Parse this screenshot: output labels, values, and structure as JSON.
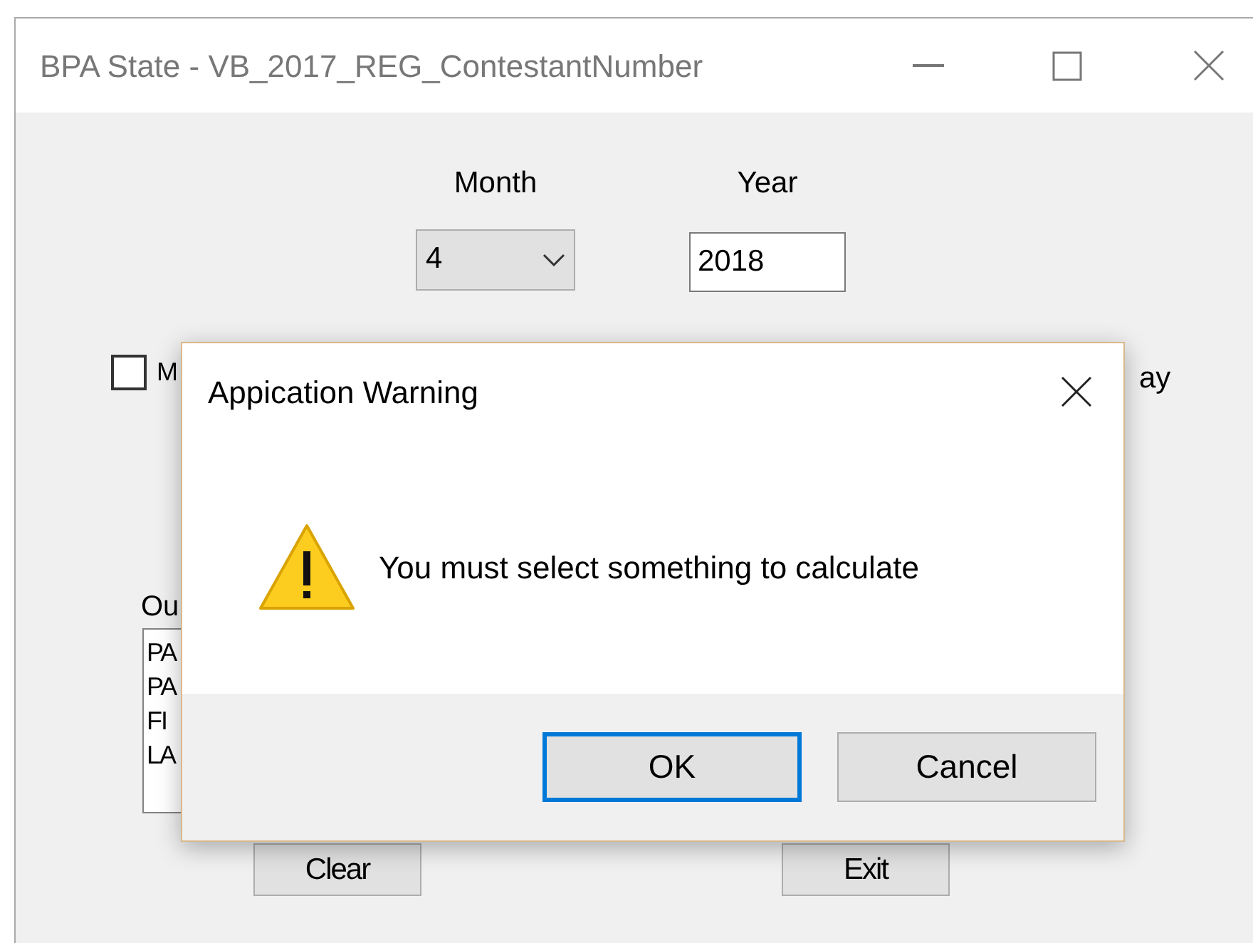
{
  "window": {
    "title": "BPA State - VB_2017_REG_ContestantNumber"
  },
  "month": {
    "label": "Month",
    "value": "4"
  },
  "year": {
    "label": "Year",
    "value": "2018"
  },
  "checkbox": {
    "label": "M",
    "checked": false
  },
  "right_label": "ay",
  "output": {
    "label": "Ou",
    "lines": [
      "PA",
      "PA",
      "FI",
      "LA"
    ]
  },
  "buttons": [
    "Clear",
    "Exit"
  ],
  "dialog": {
    "title": "Appication Warning",
    "message": "You must select something to calculate",
    "buttons": [
      {
        "label": "OK",
        "selected": true
      },
      {
        "label": "Cancel",
        "selected": false
      }
    ]
  }
}
